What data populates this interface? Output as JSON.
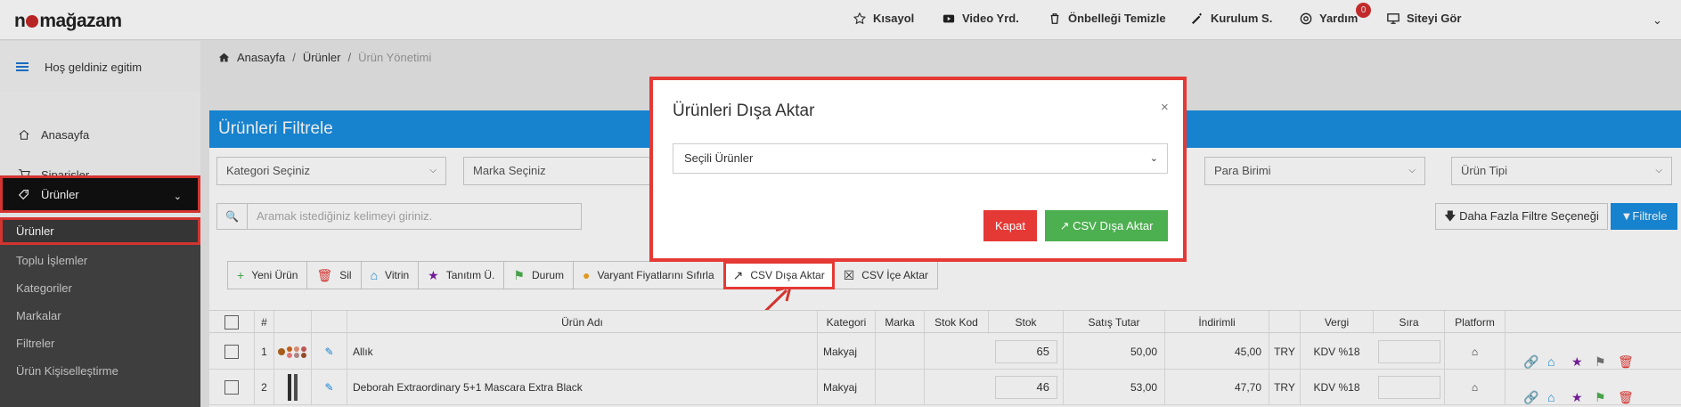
{
  "brand": {
    "logo_pre": "n",
    "logo_post": "mağazam"
  },
  "topnav": [
    {
      "label": "Kısayol",
      "icon": "star-icon"
    },
    {
      "label": "Video Yrd.",
      "icon": "video-icon"
    },
    {
      "label": "Önbelleği Temizle",
      "icon": "trash-icon"
    },
    {
      "label": "Kurulum S.",
      "icon": "wand-icon"
    },
    {
      "label": "Yardım",
      "icon": "lifebuoy-icon",
      "badge": "0"
    },
    {
      "label": "Siteyi Gör",
      "icon": "monitor-icon"
    }
  ],
  "sidebar": {
    "welcome": "Hoş geldiniz egitim",
    "items": [
      {
        "label": "Anasayfa",
        "icon": "home-icon"
      },
      {
        "label": "Siparişler",
        "icon": "cart-icon"
      },
      {
        "label": "Ürünler",
        "icon": "tags-icon"
      }
    ],
    "sub_items": [
      "Ürünler",
      "Toplu İşlemler",
      "Kategoriler",
      "Markalar",
      "Filtreler",
      "Ürün Kişiselleştirme"
    ]
  },
  "breadcrumb": {
    "home": "Anasayfa",
    "products": "Ürünler",
    "current": "Ürün Yönetimi"
  },
  "filter_panel": {
    "title": "Ürünleri Filtrele",
    "selects": [
      "Kategori Seçiniz",
      "Marka Seçiniz",
      "Para Birimi",
      "Ürün Tipi"
    ],
    "search_placeholder": "Aramak istediğiniz kelimeyi giriniz.",
    "more_button": "Daha Fazla Filtre Seçeneği",
    "filter_button": "Filtrele"
  },
  "toolbar": [
    {
      "label": "Yeni Ürün",
      "icon": "plus-icon"
    },
    {
      "label": "Sil",
      "icon": "trash-icon"
    },
    {
      "label": "Vitrin",
      "icon": "home-icon"
    },
    {
      "label": "Tanıtım Ü.",
      "icon": "star-icon"
    },
    {
      "label": "Durum",
      "icon": "flag-icon"
    },
    {
      "label": "Varyant Fiyatlarını Sıfırla",
      "icon": "coins-icon"
    },
    {
      "label": "CSV Dışa Aktar",
      "icon": "export-icon"
    },
    {
      "label": "CSV İçe Aktar",
      "icon": "excel-icon"
    }
  ],
  "table": {
    "headers": [
      "#",
      "Ürün Adı",
      "Kategori",
      "Marka",
      "Stok Kod",
      "Stok",
      "Satış Tutar",
      "İndirimli",
      "Vergi",
      "Sıra",
      "Platform"
    ],
    "rows": [
      {
        "no": "1",
        "name": "Allık",
        "category": "Makyaj",
        "stock": "65",
        "price": "50,00",
        "discount": "45,00",
        "currency": "TRY",
        "tax": "KDV %18"
      },
      {
        "no": "2",
        "name": "Deborah Extraordinary 5+1 Mascara Extra Black",
        "category": "Makyaj",
        "stock": "46",
        "price": "53,00",
        "discount": "47,70",
        "currency": "TRY",
        "tax": "KDV %18"
      }
    ]
  },
  "modal": {
    "title": "Ürünleri Dışa Aktar",
    "close": "×",
    "selected_option": "Seçili Ürünler",
    "cancel_button": "Kapat",
    "export_button": "CSV Dışa Aktar"
  },
  "colors": {
    "accent": "#1a8ee0",
    "highlight": "#e53935",
    "success": "#4caf50"
  }
}
